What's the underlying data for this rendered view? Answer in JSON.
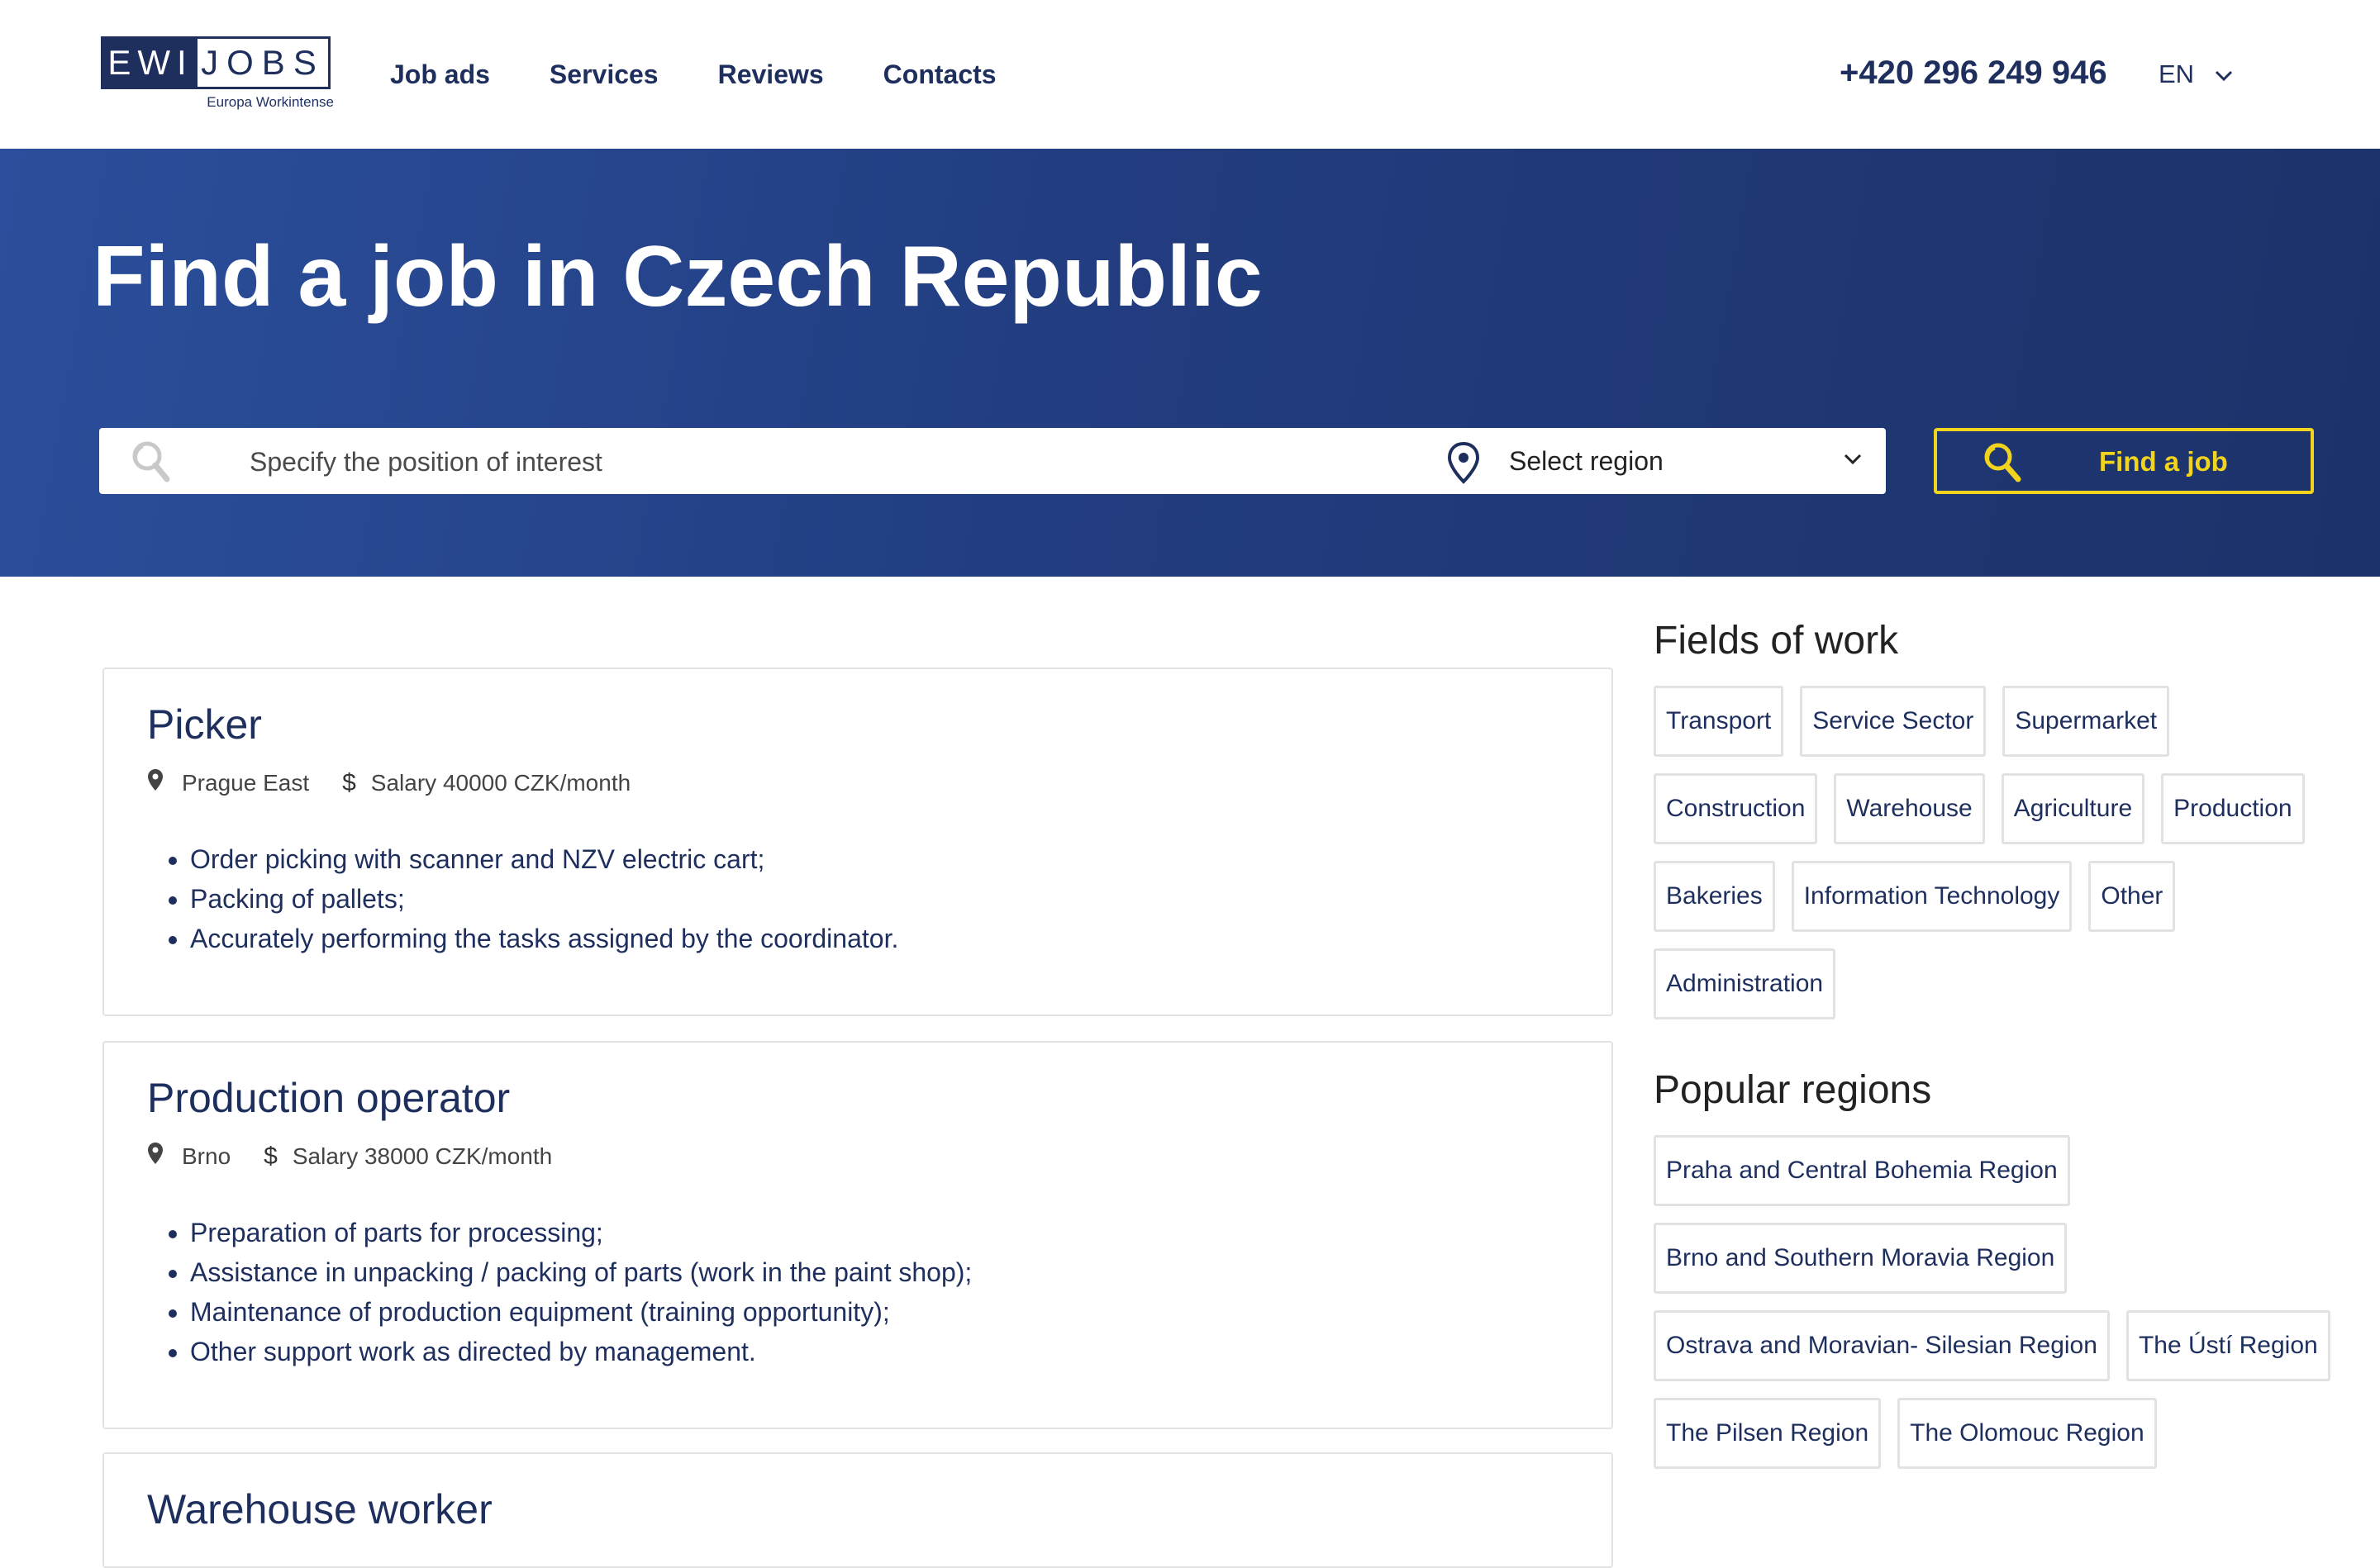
{
  "header": {
    "logo": {
      "left_text": "EWI",
      "right_text": "JOBS",
      "subtitle": "Europa Workintense"
    },
    "nav": [
      "Job ads",
      "Services",
      "Reviews",
      "Contacts"
    ],
    "phone": "+420 296 249 946",
    "language": "EN"
  },
  "hero": {
    "title": "Find a job in Czech Republic",
    "search_placeholder": "Specify the position of interest",
    "region_select": "Select region",
    "find_button": "Find a job"
  },
  "jobs": [
    {
      "title": "Picker",
      "location": "Prague East",
      "salary": "Salary 40000 CZK/month",
      "duties": [
        "Order picking with scanner and NZV electric cart;",
        "Packing of pallets;",
        "Accurately performing the tasks assigned by the coordinator."
      ]
    },
    {
      "title": "Production operator",
      "location": "Brno",
      "salary": "Salary 38000 CZK/month",
      "duties": [
        "Preparation of parts for processing;",
        "Assistance in unpacking / packing of parts (work in the paint shop);",
        "Maintenance of production equipment (training opportunity);",
        "Other support work as directed by management."
      ]
    },
    {
      "title": "Warehouse worker"
    }
  ],
  "sidebar": {
    "fields_heading": "Fields of work",
    "fields": [
      "Transport",
      "Service Sector",
      "Supermarket",
      "Construction",
      "Warehouse",
      "Agriculture",
      "Production",
      "Bakeries",
      "Information Technology",
      "Other",
      "Administration"
    ],
    "regions_heading": "Popular regions",
    "regions": [
      "Praha and Central Bohemia Region",
      "Brno and Southern Moravia Region",
      "Ostrava and Moravian- Silesian Region",
      "The Ústí Region",
      "The Pilsen Region",
      "The Olomouc Region"
    ]
  },
  "colors": {
    "navy": "#1e2f5e",
    "accent_yellow": "#f2d31d",
    "hero_start": "#2b4f9c",
    "hero_end": "#1c326a"
  },
  "icons": [
    "search-icon",
    "location-pin-icon",
    "chevron-down-icon",
    "dollar-icon"
  ]
}
